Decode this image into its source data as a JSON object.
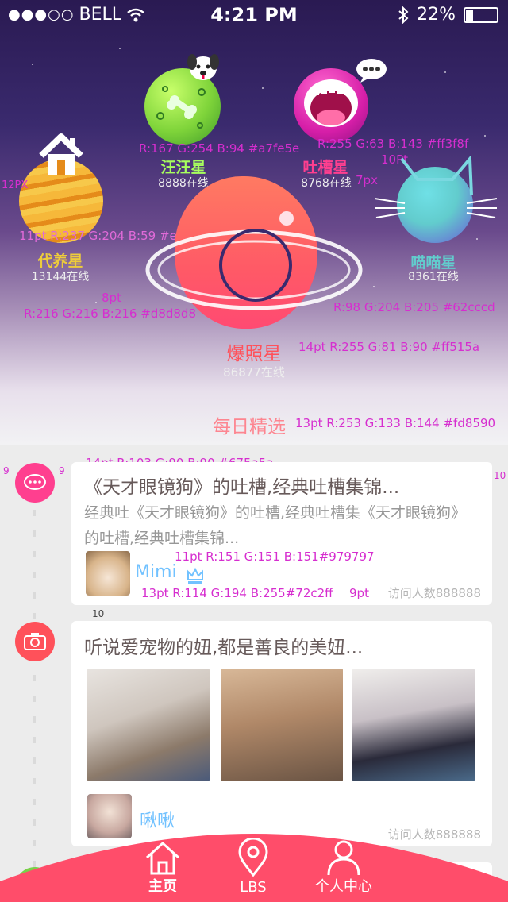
{
  "status": {
    "signal": "●●●○○",
    "carrier": "BELL",
    "time": "4:21 PM",
    "battery": "22%"
  },
  "planets": [
    {
      "name": "汪汪星",
      "count": "8888在线",
      "color": "#a7fe5e"
    },
    {
      "name": "吐槽星",
      "count": "8768在线",
      "color": "#ff3f8f"
    },
    {
      "name": "代养星",
      "count": "13144在线",
      "color": "#edcc3b"
    },
    {
      "name": "喵喵星",
      "count": "8361在线",
      "color": "#62cccd"
    },
    {
      "name": "爆照星",
      "count": "86877在线",
      "color": "#ff515a"
    }
  ],
  "annotations": {
    "wangwang": "R:167 G:254 B:94 #a7fe5e",
    "tucao": "R:255 G:63 B:143 #ff3f8f",
    "tucao_gap": "10Pt",
    "tucao_px": "7px",
    "left12": "12PX",
    "daiyang": "11pt R:237 G:204 B:59 #edcc3b",
    "gap8": "8pt",
    "grey": "R:216 G:216 B:216 #d8d8d8",
    "miaomiao": "R:98 G:204 B:205 #62cccd",
    "baozhao": "14pt R:255 G:81 B:90 #ff515a",
    "daily": "13pt R:253 G:133 B:144 #fd8590",
    "title": "14pt R:103 G:90 B:90 #675a5a",
    "desc": "11pt R:151 G:151 B:151#979797",
    "user": "13pt R:114 G:194 B:255#72c2ff",
    "gap9pt": "9pt",
    "n9a": "9",
    "n9b": "9",
    "n10a": "10",
    "n10b": "10",
    "n10c": "10"
  },
  "daily_title": "每日精选",
  "cards": [
    {
      "title": "《天才眼镜狗》的吐槽,经典吐槽集锦...",
      "desc": "经典吐《天才眼镜狗》的吐槽,经典吐槽集《天才眼镜狗》的吐槽,经典吐槽集锦...",
      "user": "Mimi",
      "visits": "访问人数888888"
    },
    {
      "title": "听说爱宠物的妞,都是善良的美妞...",
      "user": "啾啾",
      "visits": "访问人数888888"
    }
  ],
  "tabs": [
    {
      "label": "主页"
    },
    {
      "label": "LBS"
    },
    {
      "label": "个人中心"
    }
  ],
  "colors": {
    "accent": "#ff4d6a",
    "tabbar": "#ff4d6a",
    "title": "#675a5a",
    "desc": "#979797",
    "user": "#72c2ff"
  }
}
